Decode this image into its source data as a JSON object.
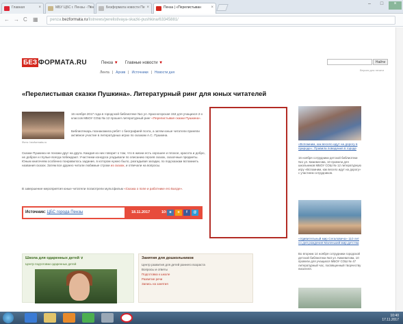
{
  "browser": {
    "tabs": [
      {
        "label": "Главная",
        "active": false
      },
      {
        "label": "МБУ ЦБС г. Пензы - Пен",
        "active": false
      },
      {
        "label": "Безформата новости Пе",
        "active": false
      },
      {
        "label": "Пенза | «Перелистыван",
        "active": true
      }
    ],
    "url_prefix": "penza.",
    "url_domain": "bezformata.ru",
    "url_rest": "/listnews/perelistivaya-skazki-pushkina/63345881/"
  },
  "site": {
    "logo_prefix": "БЕЗ",
    "logo_suffix": "ФОРМАТА.RU",
    "city": "Пенза",
    "main_news": "Главные новости",
    "search_button": "Найти",
    "subnav": [
      "Лента",
      "Архив",
      "Источники",
      "Новости дня"
    ],
    "right_small": "Версия для печати"
  },
  "article": {
    "title": "«Перелистывая сказки Пушкина». Литературный ринг для юных читателей",
    "thumb_caption": "Фото: bezformata.ru",
    "p1": "16 ноября 2017 года в городской библиотеке №1 ул. Красногорская 153 для учащихся 2-х классов МБОУ СОШ № 12 прошел литературный ринг",
    "p1_link": "«Перелистывая сказки Пушкина».",
    "p2": "Библиотекарь познакомила ребят с биографией поэта, а затем юные читатели приняли активное участие в литературных играх по сказкам А.С. Пушкина.",
    "p3": "Сказки Пушкина не похожи друг на друга. Каждая из них говорит о том, что в жизни есть хорошее и плохое, красота и добро, не доброе и глупые всегда побеждают. Участники конкурса угадывали по описанию героев сказок, сказочные предметы. Юным книгочеям особенно понравилось задание, в котором нужно было, разгадывая загадки, по подсказкам вспомнить названия сказок. Затем все дружно читали любимые строки",
    "p3_link": "из сказок,",
    "p3_end": "и отвечали на вопросы.",
    "p4": "В завершение мероприятия юные читатели посмотрели мультфильм",
    "p4_link": "«Сказка о попе и работнике его Балде».",
    "source_label": "Источник:",
    "source_name": "ЦБС города Пензы",
    "date": "18.11.2017",
    "time": "10:32"
  },
  "widgets": {
    "w1_title": "Школа для одаренных детей",
    "w1_sub": "Центр подготовки одаренных детей",
    "w2_title": "Занятия для дошкольников",
    "w2_rows": [
      "Центр развития для детей раннего возраста",
      "Вопросы и ответы"
    ],
    "w2_links": [
      "Подготовка к школе",
      "Развитие речи",
      "Запись на занятия"
    ]
  },
  "right_col": [
    {
      "link": "«Вспомним, как весело идут на дорогу в природе»: Правила поведения в городе",
      "text": "16 ноября сотрудники детской библиотеки №1 ул. Кижеватова, 10 провели для школьников МБОУ СОШ № 12 литературную игру «Вспомним, как весело идут на дорогу» с участием сотрудников."
    },
    {
      "link": "«Удивительный мир Сегаловича» 110 лет со дня рождения Маленький мир детства",
      "text": "Во вторник 14 ноября сотрудники городской детской библиотеки №3 ул. Кижеватова, 10 провели для учащихся МБОУ СОШ № 47 литературный час, посвященный творчеству писателя."
    }
  ],
  "taskbar": {
    "time": "10:40",
    "date": "17.11.2017"
  },
  "colors": {
    "brand_red": "#d4281e",
    "link_blue": "#2b5fae"
  }
}
